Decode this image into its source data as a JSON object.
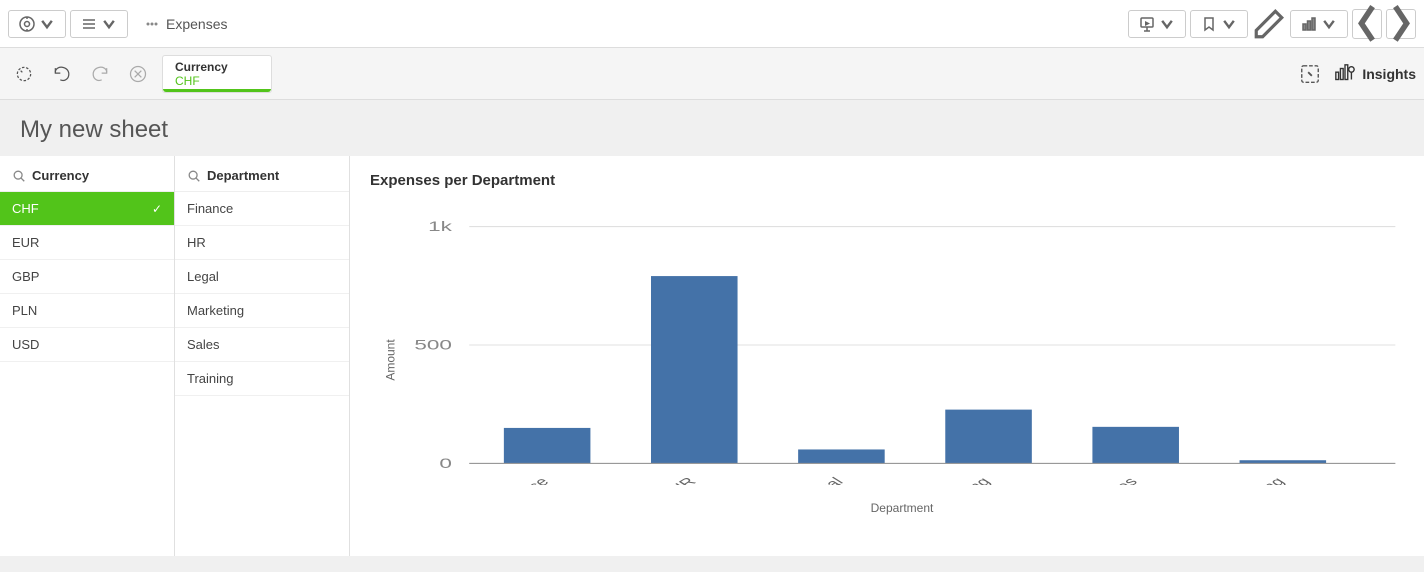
{
  "toolbar": {
    "app_icon": "compass-icon",
    "app_name": "Expenses",
    "list_btn_label": "",
    "present_btn_label": "",
    "bookmark_btn_label": "",
    "edit_icon": "pencil-icon",
    "chart_btn_label": "",
    "nav_back": "‹",
    "nav_forward": "›",
    "insights_label": "Insights"
  },
  "filter_bar": {
    "selection_icon": "selection-icon",
    "back_icon": "back-icon",
    "forward_icon": "forward-icon",
    "clear_icon": "clear-icon",
    "filter_chip": {
      "label": "Currency",
      "value": "CHF"
    },
    "lasso_icon": "lasso-icon"
  },
  "sheet": {
    "title": "My new sheet"
  },
  "currency_panel": {
    "header": "Currency",
    "items": [
      {
        "label": "CHF",
        "selected": true
      },
      {
        "label": "EUR",
        "selected": false
      },
      {
        "label": "GBP",
        "selected": false
      },
      {
        "label": "PLN",
        "selected": false
      },
      {
        "label": "USD",
        "selected": false
      }
    ]
  },
  "department_panel": {
    "header": "Department",
    "items": [
      {
        "label": "Finance"
      },
      {
        "label": "HR"
      },
      {
        "label": "Legal"
      },
      {
        "label": "Marketing"
      },
      {
        "label": "Sales"
      },
      {
        "label": "Training"
      }
    ]
  },
  "chart": {
    "title": "Expenses per Department",
    "y_axis_label": "Amount",
    "x_axis_label": "Department",
    "y_max": 1000,
    "y_ticks": [
      "1k",
      "500",
      "0"
    ],
    "bars": [
      {
        "label": "Finance",
        "value": 150
      },
      {
        "label": "HR",
        "value": 790
      },
      {
        "label": "Legal",
        "value": 60
      },
      {
        "label": "Marketing",
        "value": 230
      },
      {
        "label": "Sales",
        "value": 155
      },
      {
        "label": "Training",
        "value": 15
      }
    ],
    "bar_color": "#4472a8"
  }
}
